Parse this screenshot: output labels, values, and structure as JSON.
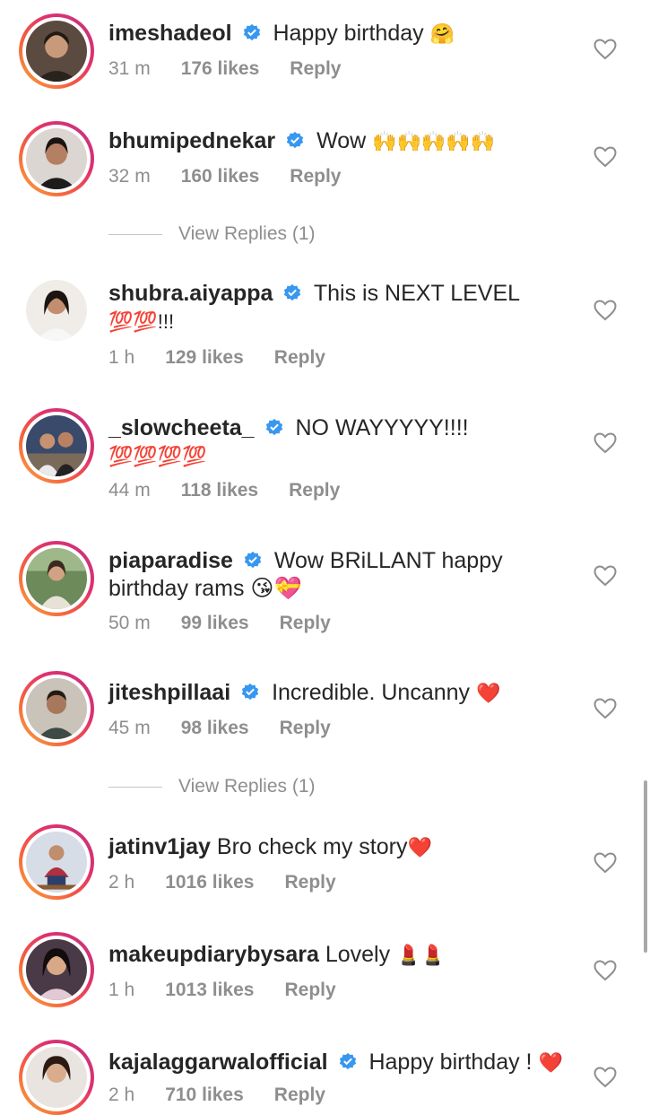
{
  "comments": [
    {
      "username": "imeshadeol",
      "verified": true,
      "text": "Happy birthday",
      "emoji": "🤗",
      "time": "31 m",
      "likes": "176 likes",
      "reply": "Reply"
    },
    {
      "username": "bhumipednekar",
      "verified": true,
      "text": "Wow",
      "emoji": "🙌🙌🙌🙌🙌",
      "time": "32 m",
      "likes": "160 likes",
      "reply": "Reply"
    },
    {
      "username": "shubra.aiyappa",
      "verified": true,
      "text": "This is NEXT LEVEL",
      "text2": "💯💯!!!",
      "time": "1 h",
      "likes": "129 likes",
      "reply": "Reply"
    },
    {
      "username": "_slowcheeta_",
      "verified": true,
      "text": "NO WAYYYYY!!!!",
      "text2": "💯💯💯💯",
      "time": "44 m",
      "likes": "118 likes",
      "reply": "Reply"
    },
    {
      "username": "piaparadise",
      "verified": true,
      "text": "Wow BRiLLANT happy",
      "text2": "birthday rams 😘💝",
      "time": "50 m",
      "likes": "99 likes",
      "reply": "Reply"
    },
    {
      "username": "jiteshpillaai",
      "verified": true,
      "text": "Incredible. Uncanny",
      "emoji": "❤️",
      "time": "45 m",
      "likes": "98 likes",
      "reply": "Reply"
    },
    {
      "username": "jatinv1jay",
      "verified": false,
      "text": "Bro check my story",
      "emoji": "❤️",
      "time": "2 h",
      "likes": "1016 likes",
      "reply": "Reply"
    },
    {
      "username": "makeupdiarybysara",
      "verified": false,
      "text": "Lovely",
      "emoji": "💄💄",
      "time": "1 h",
      "likes": "1013 likes",
      "reply": "Reply"
    },
    {
      "username": "kajalaggarwalofficial",
      "verified": true,
      "text": "Happy birthday !",
      "emoji": "❤️",
      "time": "2 h",
      "likes": "710 likes",
      "reply": "Reply"
    }
  ],
  "view_replies": [
    "View Replies (1)",
    "View Replies (1)"
  ],
  "colors": {
    "accent_verified": "#3897f0",
    "meta": "#8e8e8e",
    "heart": "#8e8e8e"
  }
}
